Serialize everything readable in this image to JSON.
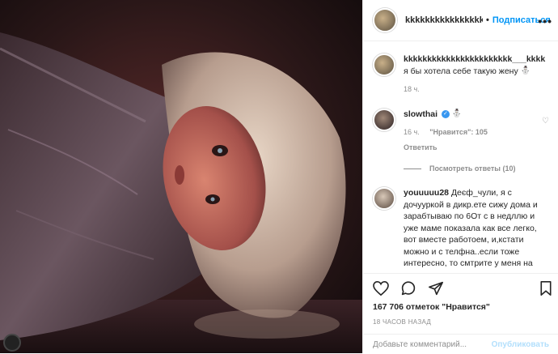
{
  "header": {
    "username": "kkkkkkkkkkkkkkkkkk",
    "separator": "•",
    "follow_label": "Подписаться",
    "more_glyph": "•••"
  },
  "caption": {
    "username": "kkkkkkkkkkkkkkkkkkkkkkk___kkkk",
    "text": "я бы хотела себе такую жену",
    "emoji": "⛄",
    "time": "18 ч."
  },
  "comments": [
    {
      "username": "slowthai",
      "emoji": "⛄",
      "time": "16 ч.",
      "likes": "\"Нравится\": 105",
      "reply": "Ответить",
      "view_replies": "Посмотреть ответы (10)"
    },
    {
      "username": "youuuuu28",
      "text": "Деєф_чули, я с дочууркой в дикр.ете сижу дома и зарабтываю по 6От с в недллю и уже маме показала как все легко, вот вместе работоем, и,кстати можно и с телфна..если тоже интересно, то смтрите у меня на стр.чке"
    }
  ],
  "footer": {
    "likes": "167 706 отметок \"Нравится\"",
    "time": "18 ЧАСОВ НАЗАД",
    "comment_placeholder": "Добавьте комментарий...",
    "publish_label": "Опубликовать"
  },
  "icons": {
    "like": "heart-icon",
    "comment": "comment-icon",
    "share": "share-icon",
    "save": "bookmark-icon"
  },
  "colors": {
    "accent": "#0095f6",
    "verified": "#3897f0",
    "muted": "#8e8e8e",
    "publish_disabled": "#b2dffc"
  }
}
